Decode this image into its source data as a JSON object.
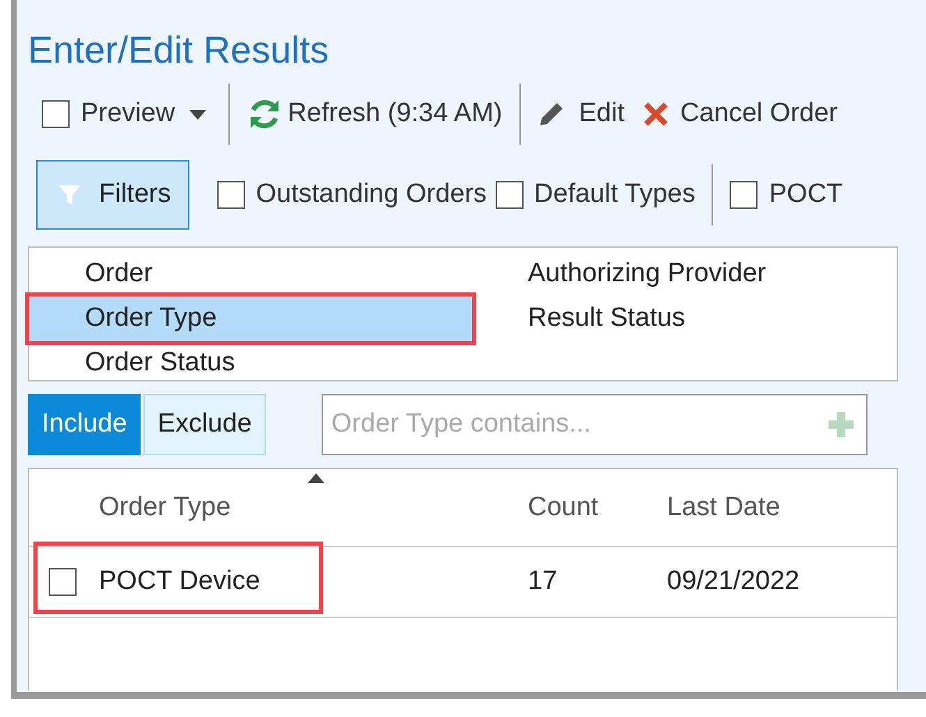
{
  "window": {
    "title": "Enter/Edit Results"
  },
  "toolbar": [
    {
      "kind": "check",
      "label": "Preview",
      "checked": false
    },
    {
      "kind": "dropdown"
    },
    {
      "kind": "sep"
    },
    {
      "kind": "refresh",
      "label": "Refresh (9:34 AM)"
    },
    {
      "kind": "sep"
    },
    {
      "kind": "edit",
      "label": "Edit"
    },
    {
      "kind": "cancel",
      "label": "Cancel Order"
    }
  ],
  "filter_bar": [
    {
      "kind": "filters",
      "label": "Filters",
      "selected": true
    },
    {
      "kind": "check",
      "label": "Outstanding Orders",
      "checked": false
    },
    {
      "kind": "check",
      "label": "Default Types",
      "checked": false
    },
    {
      "kind": "sep"
    },
    {
      "kind": "check",
      "label": "POCT",
      "checked": false
    }
  ],
  "filter_fields": [
    [
      {
        "label": "Order",
        "selected": false,
        "highlighted": false
      },
      {
        "label": "Order Type",
        "selected": true,
        "highlighted": true
      },
      {
        "label": "Order Status",
        "selected": false,
        "highlighted": false
      }
    ],
    [
      {
        "label": "Authorizing Provider",
        "selected": false,
        "highlighted": false
      },
      {
        "label": "Result Status",
        "selected": false,
        "highlighted": false
      }
    ]
  ],
  "mode_tabs": [
    {
      "label": "Include",
      "selected": true
    },
    {
      "label": "Exclude",
      "selected": false
    }
  ],
  "search": {
    "placeholder": "Order Type contains..."
  },
  "table": {
    "columns": [
      {
        "label": "Order Type",
        "sorted": true
      },
      {
        "label": "Count",
        "sorted": false
      },
      {
        "label": "Last Date",
        "sorted": false
      }
    ],
    "rows": [
      {
        "checked": false,
        "highlighted": true,
        "cells": [
          "POCT Device",
          "17",
          "09/21/2022"
        ]
      }
    ]
  }
}
